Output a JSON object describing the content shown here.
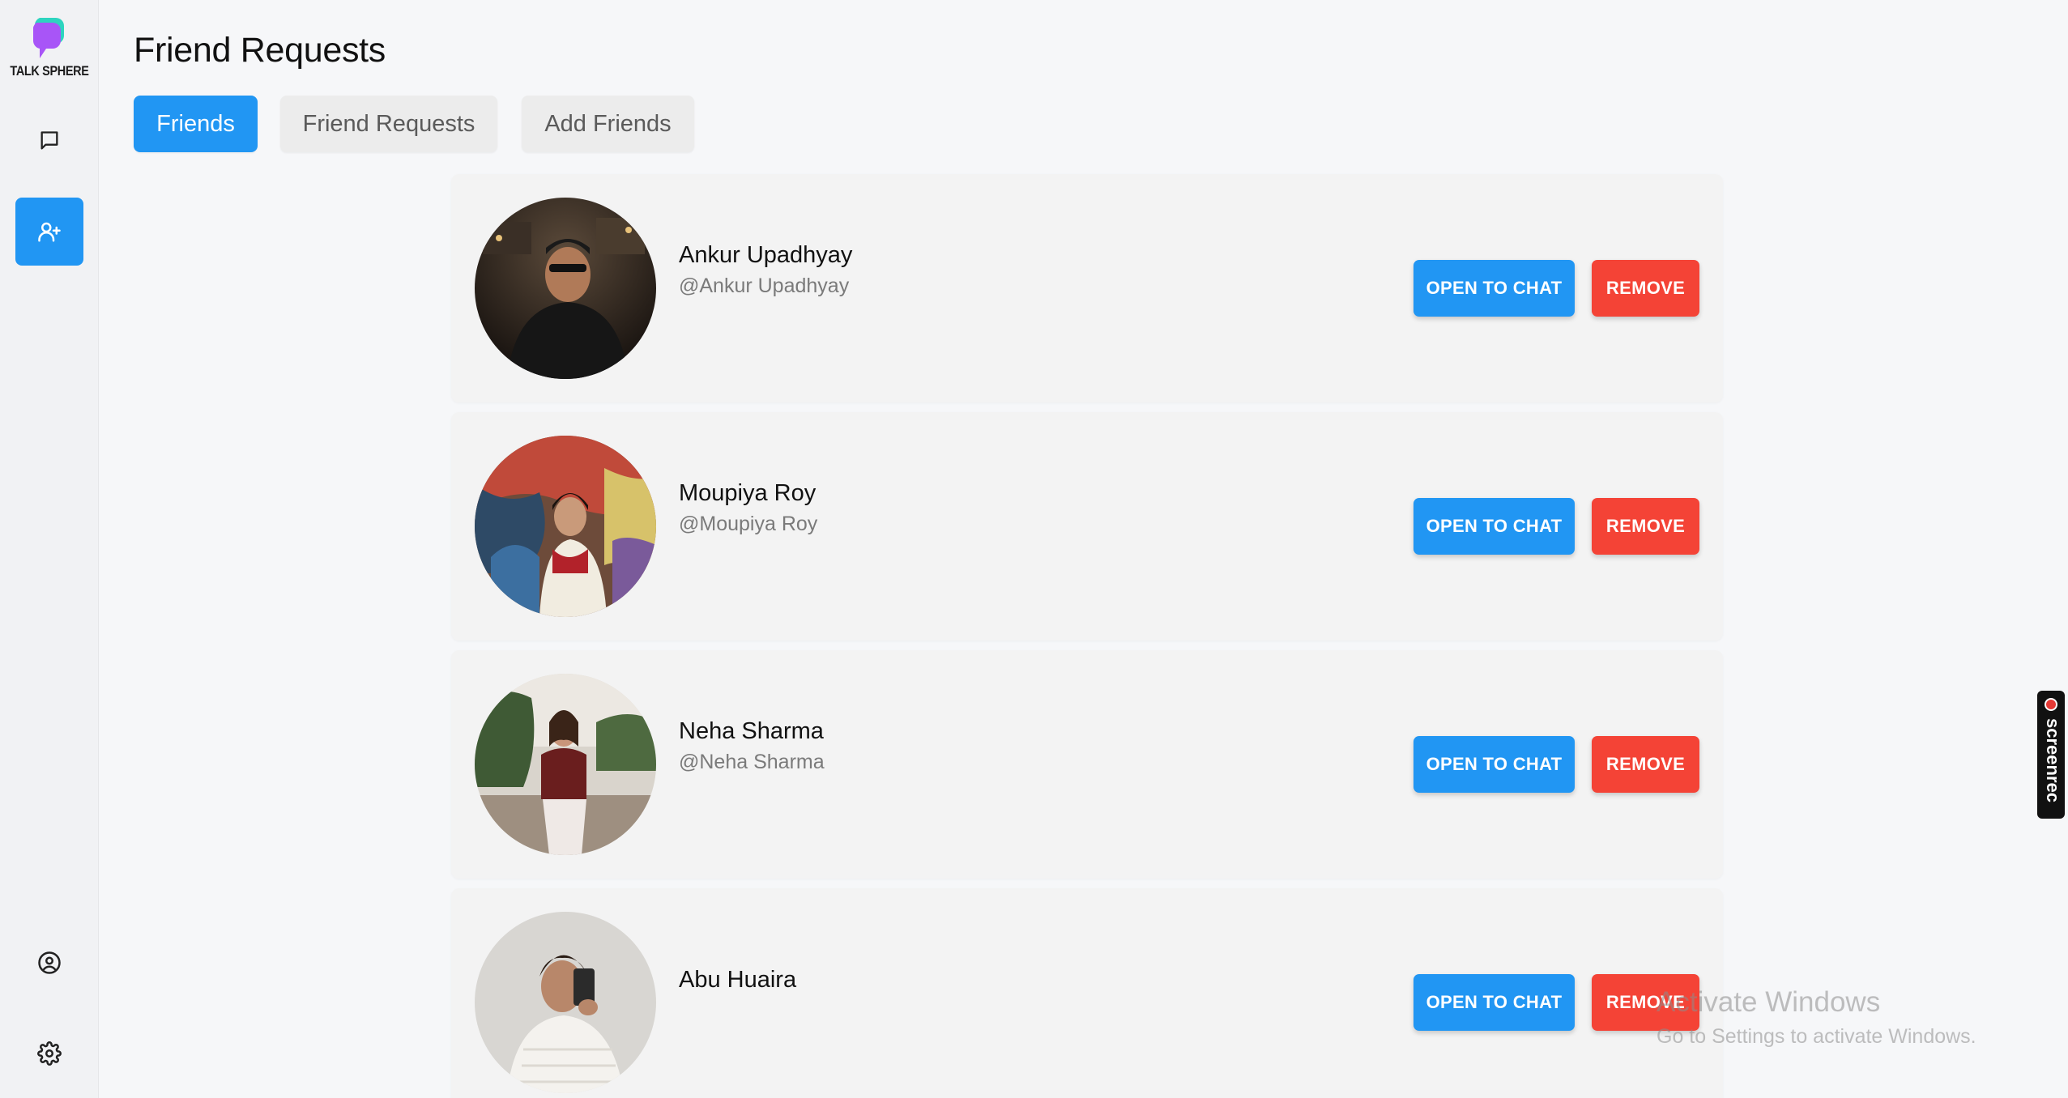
{
  "app": {
    "name": "TALK SPHERE"
  },
  "page": {
    "title": "Friend Requests"
  },
  "tabs": [
    {
      "label": "Friends",
      "active": true
    },
    {
      "label": "Friend Requests",
      "active": false
    },
    {
      "label": "Add Friends",
      "active": false
    }
  ],
  "sidebar": {
    "items": [
      {
        "icon": "chat-bubble-icon",
        "active": false
      },
      {
        "icon": "add-user-icon",
        "active": true
      },
      {
        "icon": "profile-icon",
        "active": false
      },
      {
        "icon": "gear-icon",
        "active": false
      }
    ]
  },
  "friends": [
    {
      "name": "Ankur Upadhyay",
      "handle": "@Ankur Upadhyay",
      "chat_label": "OPEN TO CHAT",
      "remove_label": "REMOVE"
    },
    {
      "name": "Moupiya Roy",
      "handle": "@Moupiya Roy",
      "chat_label": "OPEN TO CHAT",
      "remove_label": "REMOVE"
    },
    {
      "name": "Neha Sharma",
      "handle": "@Neha Sharma",
      "chat_label": "OPEN TO CHAT",
      "remove_label": "REMOVE"
    },
    {
      "name": "Abu Huaira",
      "handle": "",
      "chat_label": "OPEN TO CHAT",
      "remove_label": "REMOVE"
    }
  ],
  "overlay": {
    "activate_title": "Activate Windows",
    "activate_sub": "Go to Settings to activate Windows.",
    "recorder": "screenrec"
  },
  "colors": {
    "primary": "#2196f3",
    "danger": "#f44336",
    "logo_purple": "#a855f7",
    "logo_teal": "#2dd4bf"
  }
}
